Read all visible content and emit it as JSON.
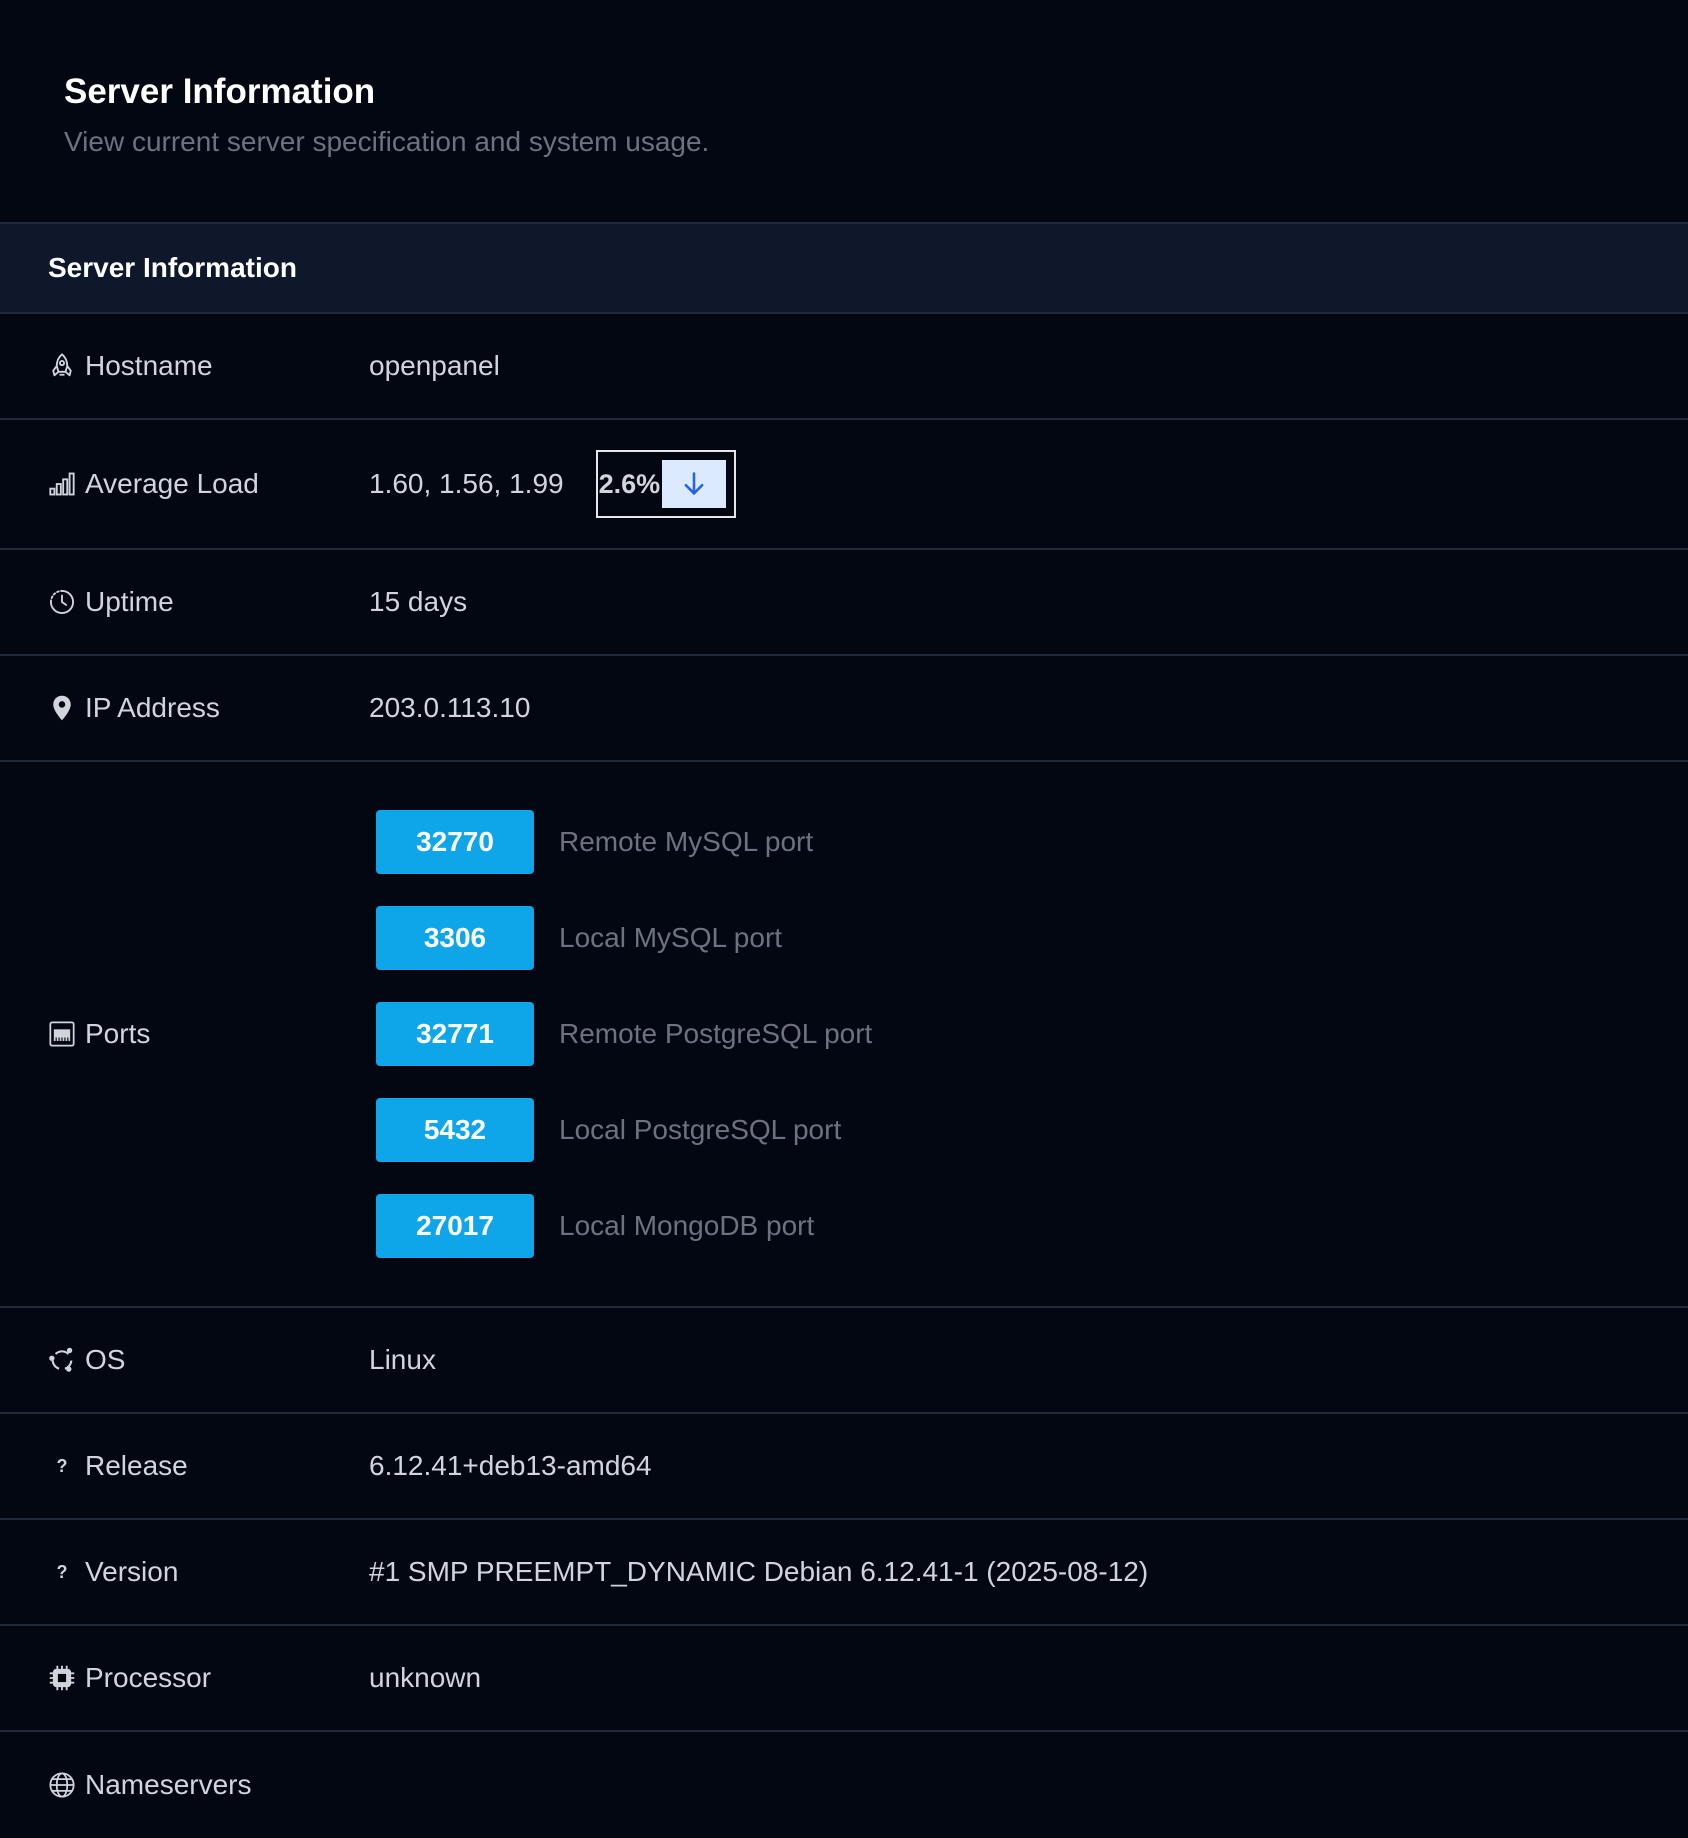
{
  "header": {
    "title": "Server Information",
    "subtitle": "View current server specification and system usage."
  },
  "panel": {
    "title": "Server Information"
  },
  "rows": {
    "hostname": {
      "label": "Hostname",
      "value": "openpanel",
      "icon": "rocket-icon"
    },
    "load": {
      "label": "Average Load",
      "value": "1.60, 1.56, 1.99",
      "percent": "2.6%",
      "icon": "bar-chart-icon",
      "arrow_icon": "arrow-down-icon"
    },
    "uptime": {
      "label": "Uptime",
      "value": "15 days",
      "icon": "clock-icon"
    },
    "ip": {
      "label": "IP Address",
      "value": "203.0.113.10",
      "icon": "map-pin-icon"
    },
    "ports": {
      "label": "Ports",
      "icon": "ethernet-port-icon",
      "items": [
        {
          "port": "32770",
          "desc": "Remote MySQL port"
        },
        {
          "port": "3306",
          "desc": "Local MySQL port"
        },
        {
          "port": "32771",
          "desc": "Remote PostgreSQL port"
        },
        {
          "port": "5432",
          "desc": "Local PostgreSQL port"
        },
        {
          "port": "27017",
          "desc": "Local MongoDB port"
        }
      ]
    },
    "os": {
      "label": "OS",
      "value": "Linux",
      "icon": "ubuntu-icon"
    },
    "release": {
      "label": "Release",
      "value": "6.12.41+deb13-amd64",
      "icon": "?"
    },
    "version": {
      "label": "Version",
      "value": "#1 SMP PREEMPT_DYNAMIC Debian 6.12.41-1 (2025-08-12)",
      "icon": "?"
    },
    "processor": {
      "label": "Processor",
      "value": "unknown",
      "icon": "cpu-icon"
    },
    "nameservers": {
      "label": "Nameservers",
      "icon": "globe-icon"
    }
  }
}
